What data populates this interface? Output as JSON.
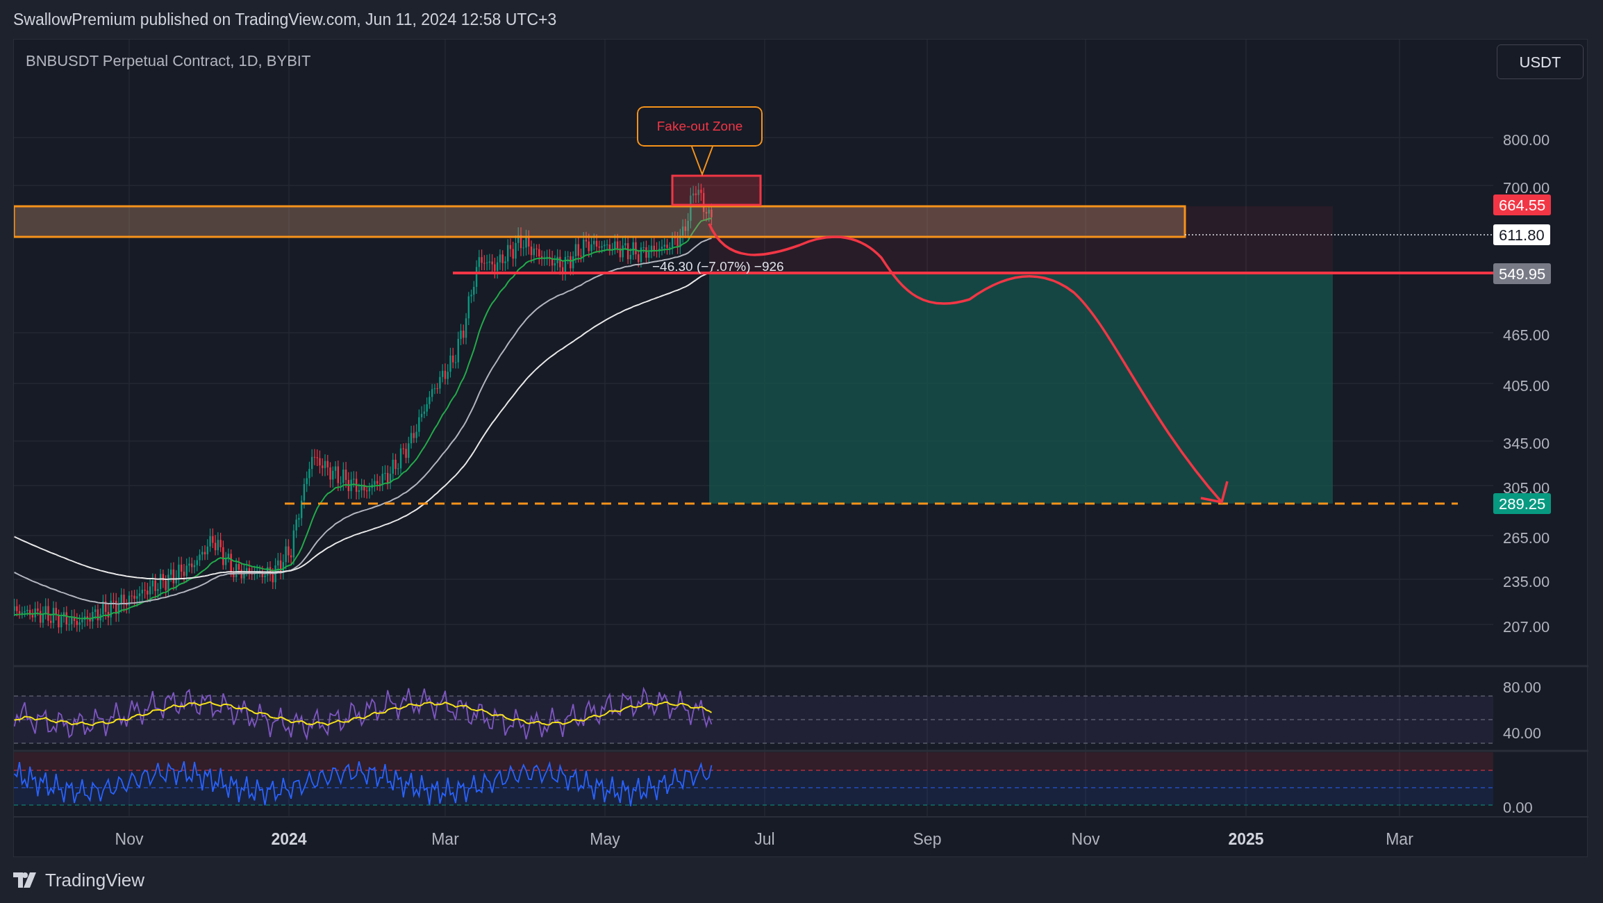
{
  "header": {
    "text": "SwallowPremium published on TradingView.com, Jun 11, 2024 12:58 UTC+3"
  },
  "chart": {
    "symbol": "BNBUSDT Perpetual Contract, 1D, BYBIT",
    "currency_button": "USDT",
    "price_axis": [
      "800.00",
      "700.00",
      "465.00",
      "405.00",
      "345.00",
      "305.00",
      "265.00",
      "235.00",
      "207.00"
    ],
    "price_tags": [
      {
        "label": "664.55",
        "kind": "sell"
      },
      {
        "label": "611.80",
        "kind": "last"
      },
      {
        "label": "549.95",
        "kind": "entry"
      },
      {
        "label": "289.25",
        "kind": "target"
      }
    ],
    "callout": "Fake-out Zone",
    "measure_label": "−46.30 (−7.07%) −926",
    "rsi_axis": [
      "80.00",
      "40.00"
    ],
    "oscillator_axis": [
      "0.00"
    ],
    "time_axis": [
      {
        "label": "Nov",
        "bold": false
      },
      {
        "label": "2024",
        "bold": true
      },
      {
        "label": "Mar",
        "bold": false
      },
      {
        "label": "May",
        "bold": false
      },
      {
        "label": "Jul",
        "bold": false
      },
      {
        "label": "Sep",
        "bold": false
      },
      {
        "label": "Nov",
        "bold": false
      },
      {
        "label": "2025",
        "bold": true
      },
      {
        "label": "Mar",
        "bold": false
      }
    ]
  },
  "footer": {
    "brand": "TradingView"
  }
}
